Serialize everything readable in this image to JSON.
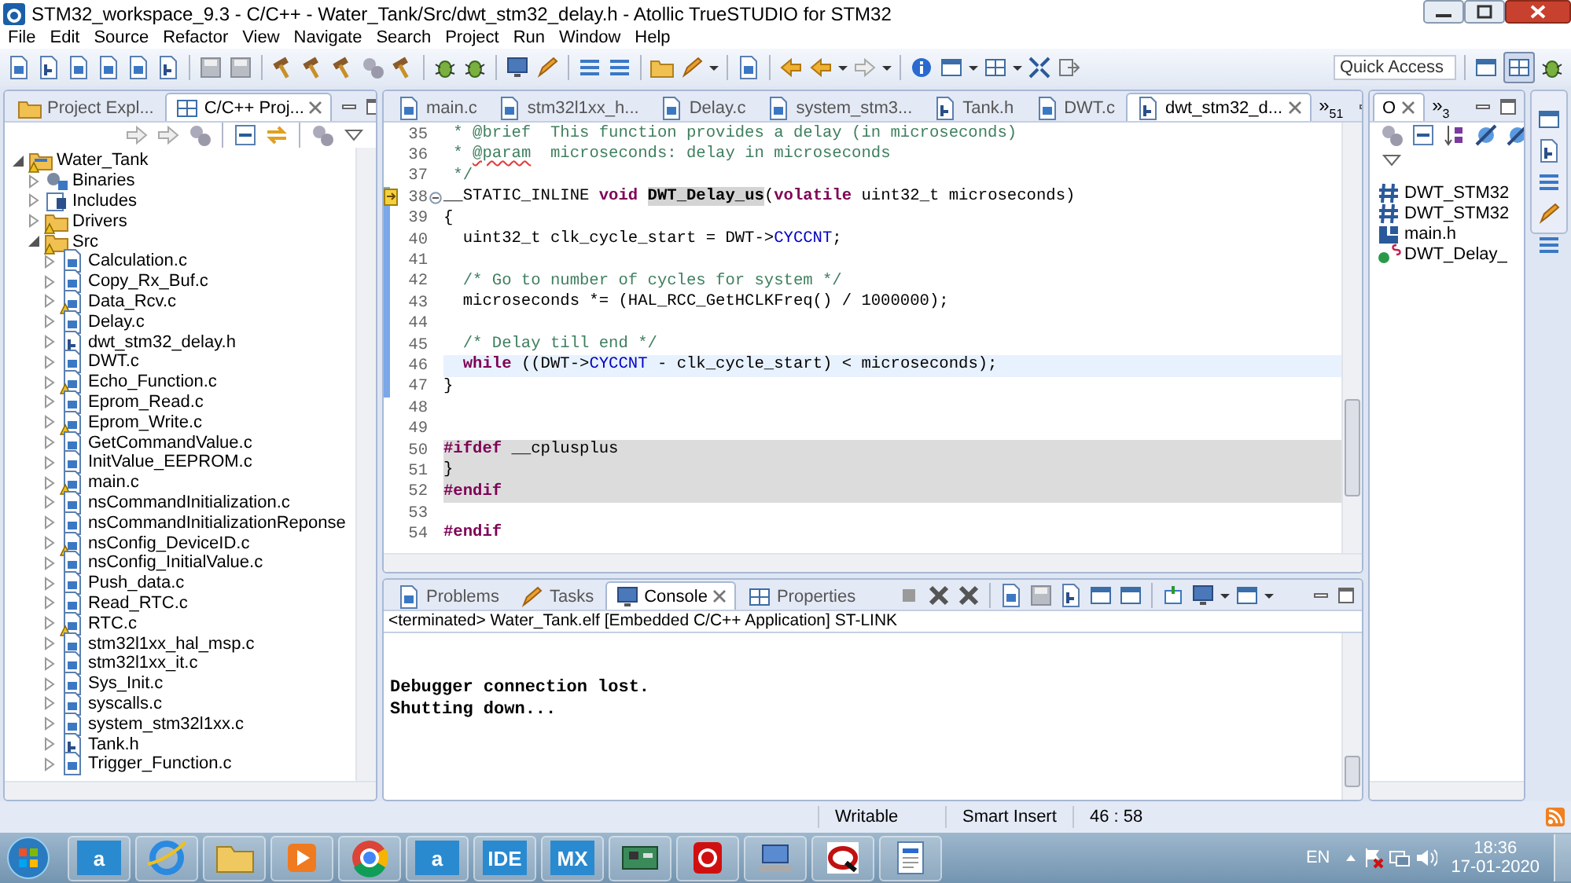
{
  "window": {
    "title": "STM32_workspace_9.3 - C/C++ - Water_Tank/Src/dwt_stm32_delay.h - Atollic TrueSTUDIO for STM32"
  },
  "menu": [
    "File",
    "Edit",
    "Source",
    "Refactor",
    "View",
    "Navigate",
    "Search",
    "Project",
    "Run",
    "Window",
    "Help"
  ],
  "quick_access": {
    "placeholder": "Quick Access"
  },
  "explorer": {
    "tabs": [
      {
        "label": "Project Expl...",
        "selected": false
      },
      {
        "label": "C/C++ Proj...",
        "selected": true
      }
    ],
    "tree": [
      {
        "label": "Water_Tank",
        "kind": "project",
        "expanded": true,
        "warning": true,
        "children": [
          {
            "label": "Binaries",
            "kind": "binaries",
            "expanded": false,
            "warning": false
          },
          {
            "label": "Includes",
            "kind": "includes",
            "expanded": false,
            "warning": false
          },
          {
            "label": "Drivers",
            "kind": "folder",
            "expanded": false,
            "warning": true
          },
          {
            "label": "Src",
            "kind": "folder",
            "expanded": true,
            "warning": true,
            "children": [
              {
                "label": "Calculation.c",
                "kind": "c-file",
                "expanded": false,
                "warning": false
              },
              {
                "label": "Copy_Rx_Buf.c",
                "kind": "c-file",
                "expanded": false,
                "warning": false
              },
              {
                "label": "Data_Rcv.c",
                "kind": "c-file",
                "expanded": false,
                "warning": true
              },
              {
                "label": "Delay.c",
                "kind": "c-file",
                "expanded": false,
                "warning": false
              },
              {
                "label": "dwt_stm32_delay.h",
                "kind": "h-file",
                "expanded": false,
                "warning": false
              },
              {
                "label": "DWT.c",
                "kind": "c-file",
                "expanded": false,
                "warning": false
              },
              {
                "label": "Echo_Function.c",
                "kind": "c-file",
                "expanded": false,
                "warning": true
              },
              {
                "label": "Eprom_Read.c",
                "kind": "c-file",
                "expanded": false,
                "warning": false
              },
              {
                "label": "Eprom_Write.c",
                "kind": "c-file",
                "expanded": false,
                "warning": true
              },
              {
                "label": "GetCommandValue.c",
                "kind": "c-file",
                "expanded": false,
                "warning": false
              },
              {
                "label": "InitValue_EEPROM.c",
                "kind": "c-file",
                "expanded": false,
                "warning": false
              },
              {
                "label": "main.c",
                "kind": "c-file",
                "expanded": false,
                "warning": true
              },
              {
                "label": "nsCommandInitialization.c",
                "kind": "c-file",
                "expanded": false,
                "warning": false
              },
              {
                "label": "nsCommandInitializationReponse",
                "kind": "c-file",
                "expanded": false,
                "warning": false
              },
              {
                "label": "nsConfig_DeviceID.c",
                "kind": "c-file",
                "expanded": false,
                "warning": true
              },
              {
                "label": "nsConfig_InitialValue.c",
                "kind": "c-file",
                "expanded": false,
                "warning": false
              },
              {
                "label": "Push_data.c",
                "kind": "c-file",
                "expanded": false,
                "warning": false
              },
              {
                "label": "Read_RTC.c",
                "kind": "c-file",
                "expanded": false,
                "warning": false
              },
              {
                "label": "RTC.c",
                "kind": "c-file",
                "expanded": false,
                "warning": true
              },
              {
                "label": "stm32l1xx_hal_msp.c",
                "kind": "c-file",
                "expanded": false,
                "warning": false
              },
              {
                "label": "stm32l1xx_it.c",
                "kind": "c-file",
                "expanded": false,
                "warning": false
              },
              {
                "label": "Sys_Init.c",
                "kind": "c-file",
                "expanded": false,
                "warning": false
              },
              {
                "label": "syscalls.c",
                "kind": "c-file",
                "expanded": false,
                "warning": false
              },
              {
                "label": "system_stm32l1xx.c",
                "kind": "c-file",
                "expanded": false,
                "warning": false
              },
              {
                "label": "Tank.h",
                "kind": "h-file",
                "expanded": false,
                "warning": false
              },
              {
                "label": "Trigger_Function.c",
                "kind": "c-file",
                "expanded": false,
                "warning": false
              }
            ]
          }
        ]
      }
    ]
  },
  "editor": {
    "tabs": [
      {
        "label": "main.c",
        "kind": "c-file",
        "selected": false
      },
      {
        "label": "stm32l1xx_h...",
        "kind": "c-file",
        "selected": false
      },
      {
        "label": "Delay.c",
        "kind": "c-file",
        "selected": false
      },
      {
        "label": "system_stm3...",
        "kind": "c-file",
        "selected": false
      },
      {
        "label": "Tank.h",
        "kind": "h-file",
        "selected": false
      },
      {
        "label": "DWT.c",
        "kind": "c-file",
        "selected": false
      },
      {
        "label": "dwt_stm32_d...",
        "kind": "h-file",
        "selected": true
      }
    ],
    "overflow": {
      "symbol": "»",
      "count": "51"
    },
    "lines": [
      {
        "number": "35",
        "in_range": false,
        "current": false,
        "shaded": false,
        "marker": false,
        "foldable": false,
        "segments": [
          {
            "kind": "comment",
            "text": " * @brief  This function provides a delay (in microseconds)"
          }
        ]
      },
      {
        "number": "36",
        "in_range": false,
        "current": false,
        "shaded": false,
        "marker": false,
        "foldable": false,
        "segments": [
          {
            "kind": "comment",
            "text": " * "
          },
          {
            "kind": "misspelled",
            "text": "@param"
          },
          {
            "kind": "comment",
            "text": "  microseconds: delay in microseconds"
          }
        ]
      },
      {
        "number": "37",
        "in_range": false,
        "current": false,
        "shaded": false,
        "marker": false,
        "foldable": false,
        "segments": [
          {
            "kind": "comment",
            "text": " */"
          }
        ]
      },
      {
        "number": "38",
        "in_range": true,
        "current": false,
        "shaded": false,
        "marker": true,
        "foldable": true,
        "segments": [
          {
            "kind": "plain",
            "text": "__STATIC_INLINE "
          },
          {
            "kind": "keyword",
            "text": "void "
          },
          {
            "kind": "occurrence",
            "text": "DWT_Delay_us"
          },
          {
            "kind": "plain",
            "text": "("
          },
          {
            "kind": "keyword",
            "text": "volatile"
          },
          {
            "kind": "plain",
            "text": " uint32_t microseconds)"
          }
        ]
      },
      {
        "number": "39",
        "in_range": true,
        "current": false,
        "shaded": false,
        "marker": false,
        "foldable": false,
        "segments": [
          {
            "kind": "plain",
            "text": "{"
          }
        ]
      },
      {
        "number": "40",
        "in_range": true,
        "current": false,
        "shaded": false,
        "marker": false,
        "foldable": false,
        "segments": [
          {
            "kind": "plain",
            "text": "  uint32_t clk_cycle_start = DWT->"
          },
          {
            "kind": "field",
            "text": "CYCCNT"
          },
          {
            "kind": "plain",
            "text": ";"
          }
        ]
      },
      {
        "number": "41",
        "in_range": true,
        "current": false,
        "shaded": false,
        "marker": false,
        "foldable": false
      },
      {
        "number": "42",
        "in_range": true,
        "current": false,
        "shaded": false,
        "marker": false,
        "foldable": false,
        "segments": [
          {
            "kind": "comment",
            "text": "  /* Go to number of cycles for system */"
          }
        ]
      },
      {
        "number": "43",
        "in_range": true,
        "current": false,
        "shaded": false,
        "marker": false,
        "foldable": false,
        "segments": [
          {
            "kind": "plain",
            "text": "  microseconds *= (HAL_RCC_GetHCLKFreq() / 1000000);"
          }
        ]
      },
      {
        "number": "44",
        "in_range": true,
        "current": false,
        "shaded": false,
        "marker": false,
        "foldable": false
      },
      {
        "number": "45",
        "in_range": true,
        "current": false,
        "shaded": false,
        "marker": false,
        "foldable": false,
        "segments": [
          {
            "kind": "comment",
            "text": "  /* Delay till end */"
          }
        ]
      },
      {
        "number": "46",
        "in_range": true,
        "current": true,
        "shaded": false,
        "marker": false,
        "foldable": false,
        "segments": [
          {
            "kind": "keyword",
            "text": "  while"
          },
          {
            "kind": "plain",
            "text": " ((DWT->"
          },
          {
            "kind": "field",
            "text": "CYCCNT"
          },
          {
            "kind": "plain",
            "text": " - clk_cycle_start) < microseconds);"
          }
        ]
      },
      {
        "number": "47",
        "in_range": true,
        "current": false,
        "shaded": false,
        "marker": false,
        "foldable": false,
        "segments": [
          {
            "kind": "plain",
            "text": "}"
          }
        ]
      },
      {
        "number": "48",
        "in_range": false,
        "current": false,
        "shaded": false,
        "marker": false,
        "foldable": false
      },
      {
        "number": "49",
        "in_range": false,
        "current": false,
        "shaded": false,
        "marker": false,
        "foldable": false
      },
      {
        "number": "50",
        "in_range": false,
        "current": false,
        "shaded": true,
        "marker": false,
        "foldable": false,
        "segments": [
          {
            "kind": "keyword",
            "text": "#ifdef"
          },
          {
            "kind": "plain",
            "text": " __cplusplus"
          }
        ]
      },
      {
        "number": "51",
        "in_range": false,
        "current": false,
        "shaded": true,
        "marker": false,
        "foldable": false,
        "segments": [
          {
            "kind": "plain",
            "text": "}"
          }
        ]
      },
      {
        "number": "52",
        "in_range": false,
        "current": false,
        "shaded": true,
        "marker": false,
        "foldable": false,
        "segments": [
          {
            "kind": "keyword",
            "text": "#endif"
          }
        ]
      },
      {
        "number": "53",
        "in_range": false,
        "current": false,
        "shaded": false,
        "marker": false,
        "foldable": false
      },
      {
        "number": "54",
        "in_range": false,
        "current": false,
        "shaded": false,
        "marker": false,
        "foldable": false,
        "segments": [
          {
            "kind": "keyword",
            "text": "#endif"
          }
        ]
      }
    ]
  },
  "outline": {
    "tab": {
      "label": "O",
      "selected": true
    },
    "overflow": {
      "symbol": "»",
      "count": "3"
    },
    "items": [
      {
        "label": "DWT_STM32",
        "kind": "macro"
      },
      {
        "label": "DWT_STM32",
        "kind": "macro"
      },
      {
        "label": "main.h",
        "kind": "include"
      },
      {
        "label": "DWT_Delay_",
        "kind": "function"
      }
    ]
  },
  "console": {
    "tabs": [
      {
        "label": "Problems",
        "selected": false
      },
      {
        "label": "Tasks",
        "selected": false
      },
      {
        "label": "Console",
        "selected": true
      },
      {
        "label": "Properties",
        "selected": false
      }
    ],
    "header": "<terminated> Water_Tank.elf [Embedded C/C++ Application] ST-LINK",
    "output": [
      "Debugger connection lost.",
      "Shutting down..."
    ]
  },
  "status_bar": [
    "Writable",
    "Smart Insert",
    "46 : 58"
  ],
  "taskbar": {
    "items": [
      {
        "kind": "start"
      },
      {
        "kind": "tile",
        "label": "a"
      },
      {
        "kind": "browser"
      },
      {
        "kind": "folder"
      },
      {
        "kind": "media"
      },
      {
        "kind": "chrome"
      },
      {
        "kind": "tile",
        "label": "a"
      },
      {
        "kind": "tile",
        "label": "IDE"
      },
      {
        "kind": "tile",
        "label": "MX"
      },
      {
        "kind": "board"
      },
      {
        "kind": "pdf"
      },
      {
        "kind": "network"
      },
      {
        "kind": "q"
      },
      {
        "kind": "document"
      }
    ],
    "language": "EN",
    "time": "18:36",
    "date": "17-01-2020"
  }
}
